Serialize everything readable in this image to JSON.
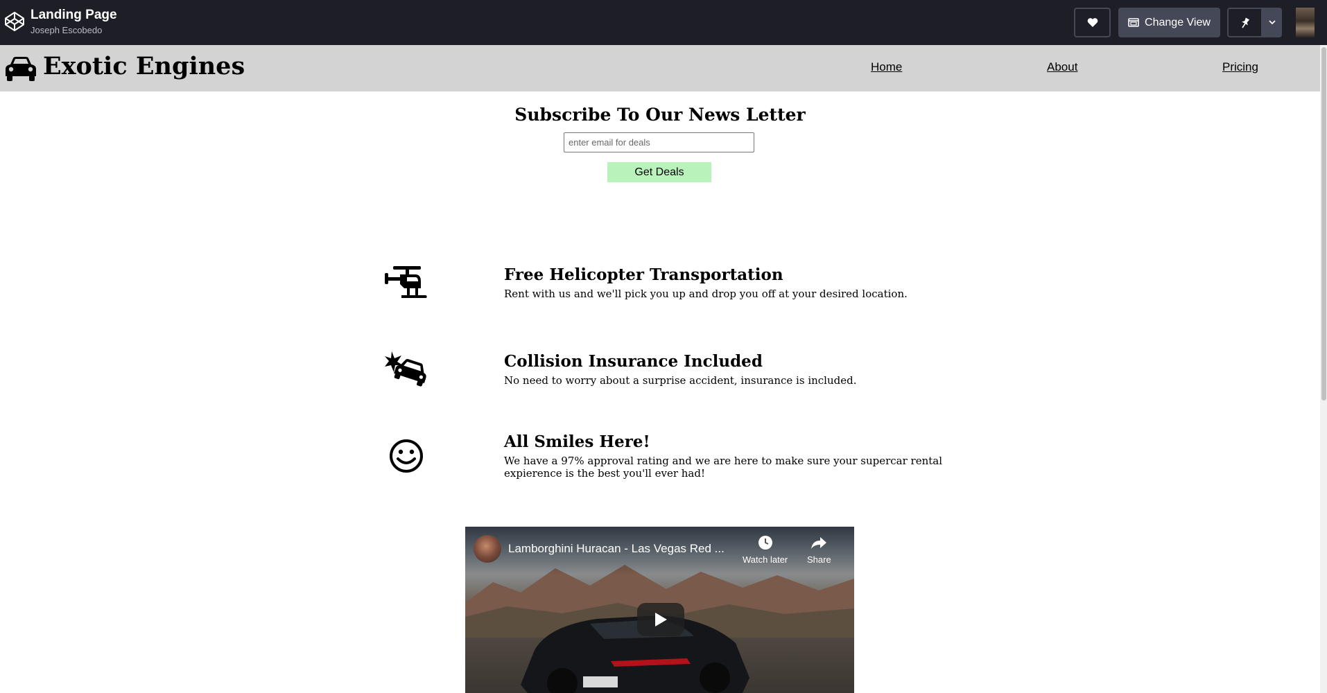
{
  "codepen": {
    "title": "Landing Page",
    "author": "Joseph Escobedo",
    "change_view_label": "Change View",
    "icons": {
      "logo": "codepen-logo-icon",
      "heart": "heart-icon",
      "change_view": "change-view-icon",
      "pin": "pin-icon",
      "dropdown": "chevron-down-icon"
    }
  },
  "site": {
    "brand": "Exotic Engines",
    "brand_icon": "car-icon",
    "nav": {
      "home": "Home",
      "about": "About",
      "pricing": "Pricing"
    },
    "colors": {
      "navbar_bg": "#d3d3d3",
      "button_bg": "#b9f3bb"
    }
  },
  "newsletter": {
    "title": "Subscribe To Our News Letter",
    "placeholder": "enter email for deals",
    "button_label": "Get Deals"
  },
  "features": [
    {
      "icon": "helicopter-icon",
      "title": "Free Helicopter Transportation",
      "description": "Rent with us and we'll pick you up and drop you off at your desired location."
    },
    {
      "icon": "car-crash-icon",
      "title": "Collision Insurance Included",
      "description": "No need to worry about a surprise accident, insurance is included."
    },
    {
      "icon": "smile-icon",
      "title": "All Smiles Here!",
      "description": "We have a 97% approval rating and we are here to make sure your supercar rental expierence is the best you'll ever had!"
    }
  ],
  "video": {
    "title": "Lamborghini Huracan - Las Vegas Red ...",
    "watch_later": "Watch later",
    "share": "Share"
  }
}
